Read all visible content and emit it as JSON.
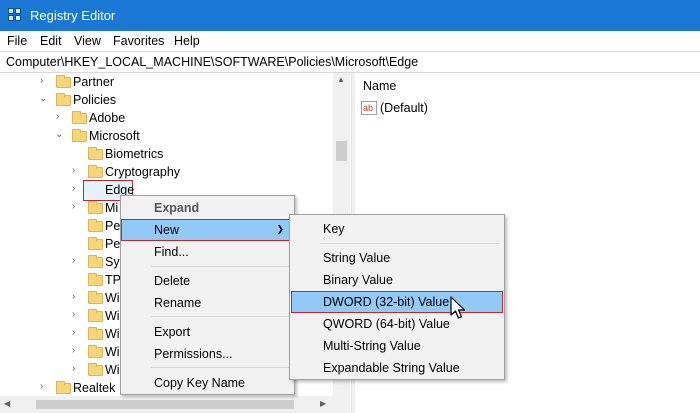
{
  "window": {
    "title": "Registry Editor",
    "icon": "registry-editor-icon"
  },
  "menu": [
    "File",
    "Edit",
    "View",
    "Favorites",
    "Help"
  ],
  "address": "Computer\\HKEY_LOCAL_MACHINE\\SOFTWARE\\Policies\\Microsoft\\Edge",
  "tree": {
    "partner": "Partner",
    "policies": "Policies",
    "adobe": "Adobe",
    "microsoft": "Microsoft",
    "biometrics": "Biometrics",
    "cryptography": "Cryptography",
    "edge": "Edge",
    "partial": [
      "Mi",
      "Pe",
      "Pe",
      "Sys",
      "TP",
      "Wi",
      "Wi",
      "Wi",
      "Wi",
      "Wi"
    ],
    "realtek": "Realtek"
  },
  "values_pane": {
    "column_name": "Name",
    "rows": [
      {
        "name": "(Default)",
        "icon": "string-value-icon"
      }
    ]
  },
  "context_menu": {
    "expand": "Expand",
    "new": "New",
    "find": "Find...",
    "delete": "Delete",
    "rename": "Rename",
    "export": "Export",
    "permissions": "Permissions...",
    "copy_key_name": "Copy Key Name"
  },
  "submenu": {
    "key": "Key",
    "string_value": "String Value",
    "binary_value": "Binary Value",
    "dword_value": "DWORD (32-bit) Value",
    "qword_value": "QWORD (64-bit) Value",
    "multi_string_value": "Multi-String Value",
    "expandable_string_value": "Expandable String Value"
  },
  "colors": {
    "titlebar": "#1a78d4",
    "highlight": "#91c9f7",
    "annotation_red": "#c0282e",
    "folder": "#f7d57b"
  }
}
